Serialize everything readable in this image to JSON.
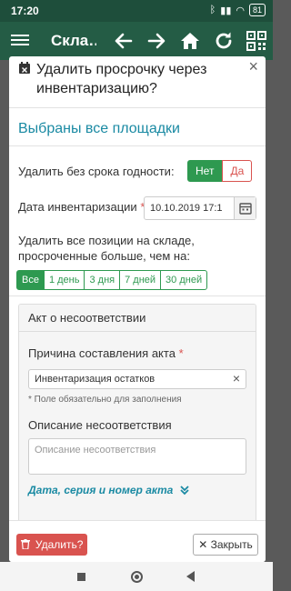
{
  "status_bar": {
    "time": "17:20",
    "battery": "81"
  },
  "app_bar": {
    "title": "Скла…"
  },
  "modal": {
    "title": "Удалить просрочку через инвентаризацию?",
    "close": "×",
    "section_title": "Выбраны все площадки",
    "no_expiry": {
      "label": "Удалить без срока годности:",
      "yes": "Нет",
      "no": "Да"
    },
    "inventory_date": {
      "label": "Дата инвентаризации",
      "required": "*",
      "value": "10.10.2019 17:1"
    },
    "range": {
      "label_line1": "Удалить все позиции на складе,",
      "label_line2": "просроченные больше, чем на:",
      "options": [
        "Все",
        "1 день",
        "3 дня",
        "7 дней",
        "30 дней"
      ],
      "selected": "Все"
    },
    "panel": {
      "title": "Акт о несоответствии",
      "reason_label": "Причина составления акта",
      "reason_required": "*",
      "reason_value": "Инвентаризация остатков",
      "reason_clear": "×",
      "required_note": "* Поле обязательно для заполнения",
      "description_label": "Описание несоответствия",
      "description_placeholder": "Описание несоответствия",
      "act_link": "Дата, серия и номер акта"
    },
    "footer": {
      "delete": "Удалить?",
      "close": "Закрыть"
    }
  },
  "colors": {
    "app_bar": "#245c45",
    "success": "#2e9950",
    "danger": "#d9534f",
    "info": "#1a8aa3"
  }
}
